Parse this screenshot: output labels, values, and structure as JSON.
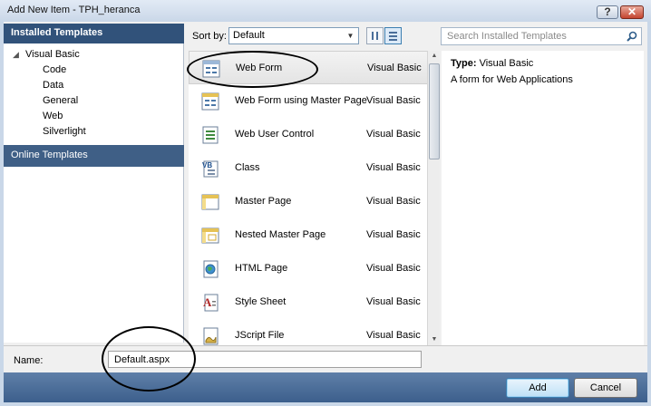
{
  "window": {
    "title": "Add New Item - TPH_heranca",
    "help_glyph": "?",
    "close_glyph": "✕"
  },
  "left_panel": {
    "installed_header": "Installed Templates",
    "tree": [
      {
        "label": "Visual Basic",
        "level": 0,
        "expanded": true
      },
      {
        "label": "Code",
        "level": 1
      },
      {
        "label": "Data",
        "level": 1
      },
      {
        "label": "General",
        "level": 1
      },
      {
        "label": "Web",
        "level": 1
      },
      {
        "label": "Silverlight",
        "level": 1
      }
    ],
    "online_header": "Online Templates"
  },
  "toolbar": {
    "sort_label": "Sort by:",
    "sort_value": "Default",
    "search_placeholder": "Search Installed Templates"
  },
  "templates": [
    {
      "name": "Web Form",
      "language": "Visual Basic",
      "icon": "web-form-icon",
      "selected": true
    },
    {
      "name": "Web Form using Master Page",
      "language": "Visual Basic",
      "icon": "web-form-master-icon"
    },
    {
      "name": "Web User Control",
      "language": "Visual Basic",
      "icon": "web-user-control-icon"
    },
    {
      "name": "Class",
      "language": "Visual Basic",
      "icon": "class-icon"
    },
    {
      "name": "Master Page",
      "language": "Visual Basic",
      "icon": "master-page-icon"
    },
    {
      "name": "Nested Master Page",
      "language": "Visual Basic",
      "icon": "nested-master-page-icon"
    },
    {
      "name": "HTML Page",
      "language": "Visual Basic",
      "icon": "html-page-icon"
    },
    {
      "name": "Style Sheet",
      "language": "Visual Basic",
      "icon": "style-sheet-icon"
    },
    {
      "name": "JScript File",
      "language": "Visual Basic",
      "icon": "jscript-file-icon"
    }
  ],
  "details": {
    "type_label": "Type:",
    "type_value": "Visual Basic",
    "description": "A form for Web Applications"
  },
  "bottom": {
    "name_label": "Name:",
    "name_value": "Default.aspx",
    "add_label": "Add",
    "cancel_label": "Cancel"
  },
  "colors": {
    "header_bg": "#31527a",
    "online_bg": "#3f5f86",
    "footer_bg": "#3c5f8c",
    "accent": "#3c7fb1"
  }
}
